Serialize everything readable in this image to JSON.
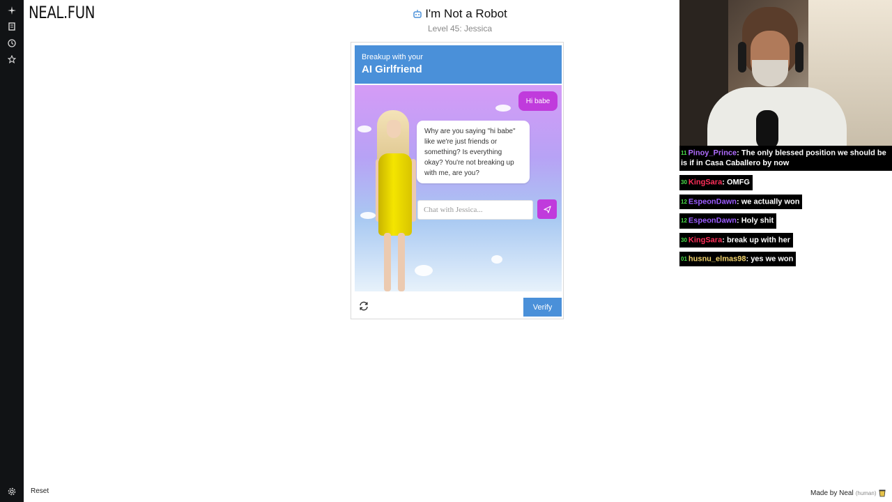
{
  "sidebar": {
    "icons": [
      "sparkle-icon",
      "document-icon",
      "clock-icon",
      "star-icon"
    ],
    "bottom_icon": "gear-icon",
    "reset_label": "Reset"
  },
  "logo": "NEAL.FUN",
  "header": {
    "title": "I'm Not a Robot",
    "level": "Level 45: Jessica"
  },
  "captcha": {
    "header_sub": "Breakup with your",
    "header_title": "AI Girlfriend",
    "user_message": "Hi babe",
    "bot_message": "Why are you saying \"hi babe\" like we're just friends or something? Is everything okay? You're not breaking up with me, are you?",
    "input_placeholder": "Chat with Jessica...",
    "verify_label": "Verify",
    "accent_color": "#4a90d9",
    "bubble_color": "#c03bdc"
  },
  "stream_chat": [
    {
      "user": "Pinoy_Prince",
      "text": "The only blessed position we should be is if in Casa Caballero by now",
      "color": "#b06cff",
      "badge": "11"
    },
    {
      "user": "KingSara",
      "text": "OMFG",
      "color": "#ff2f5a",
      "badge": "30"
    },
    {
      "user": "EspeonDawn",
      "text": "we actually won",
      "color": "#9b5cff",
      "badge": "12"
    },
    {
      "user": "EspeonDawn",
      "text": "Holy shit",
      "color": "#9b5cff",
      "badge": "12"
    },
    {
      "user": "KingSara",
      "text": "break up with her",
      "color": "#ff2f5a",
      "badge": "30"
    },
    {
      "user": "husnu_elmas98",
      "text": "yes we won",
      "color": "#f2d36b",
      "badge": "01"
    }
  ],
  "footer": {
    "made_by": "Made by Neal",
    "human": "(human)"
  }
}
